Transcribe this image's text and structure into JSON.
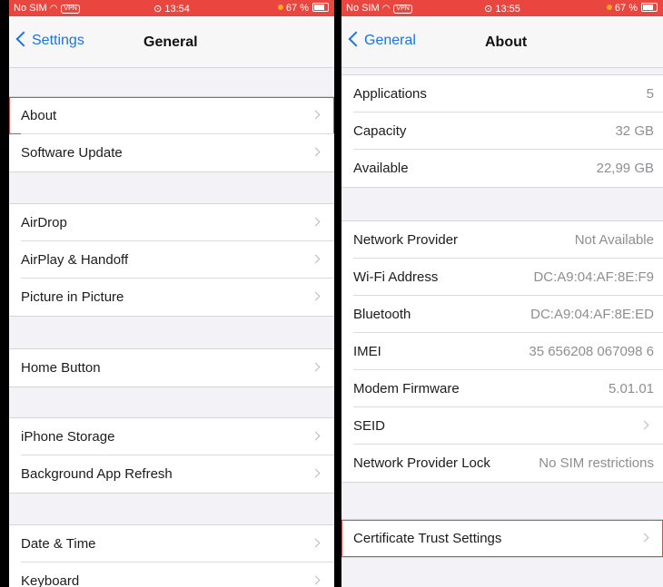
{
  "left": {
    "status": {
      "carrier": "No SIM",
      "vpn": "VPN",
      "time": "13:54",
      "battery": "67 %"
    },
    "nav": {
      "back": "Settings",
      "title": "General"
    },
    "items": {
      "about": "About",
      "software_update": "Software Update",
      "airdrop": "AirDrop",
      "airplay_handoff": "AirPlay & Handoff",
      "picture_in_picture": "Picture in Picture",
      "home_button": "Home Button",
      "iphone_storage": "iPhone Storage",
      "background_app_refresh": "Background App Refresh",
      "date_time": "Date & Time",
      "keyboard": "Keyboard"
    }
  },
  "right": {
    "status": {
      "carrier": "No SIM",
      "vpn": "VPN",
      "time": "13:55",
      "battery": "67 %"
    },
    "nav": {
      "back": "General",
      "title": "About"
    },
    "rows": {
      "applications": {
        "label": "Applications",
        "value": "5"
      },
      "capacity": {
        "label": "Capacity",
        "value": "32 GB"
      },
      "available": {
        "label": "Available",
        "value": "22,99 GB"
      },
      "network_provider": {
        "label": "Network Provider",
        "value": "Not Available"
      },
      "wifi_address": {
        "label": "Wi-Fi Address",
        "value": "DC:A9:04:AF:8E:F9"
      },
      "bluetooth": {
        "label": "Bluetooth",
        "value": "DC:A9:04:AF:8E:ED"
      },
      "imei": {
        "label": "IMEI",
        "value": "35 656208 067098 6"
      },
      "modem_firmware": {
        "label": "Modem Firmware",
        "value": "5.01.01"
      },
      "seid": {
        "label": "SEID"
      },
      "network_provider_lock": {
        "label": "Network Provider Lock",
        "value": "No SIM restrictions"
      },
      "certificate_trust_settings": {
        "label": "Certificate Trust Settings"
      }
    }
  },
  "colors": {
    "highlight": "#e8463f",
    "accent": "#1a73e8",
    "status_bar": "#e8463f"
  }
}
